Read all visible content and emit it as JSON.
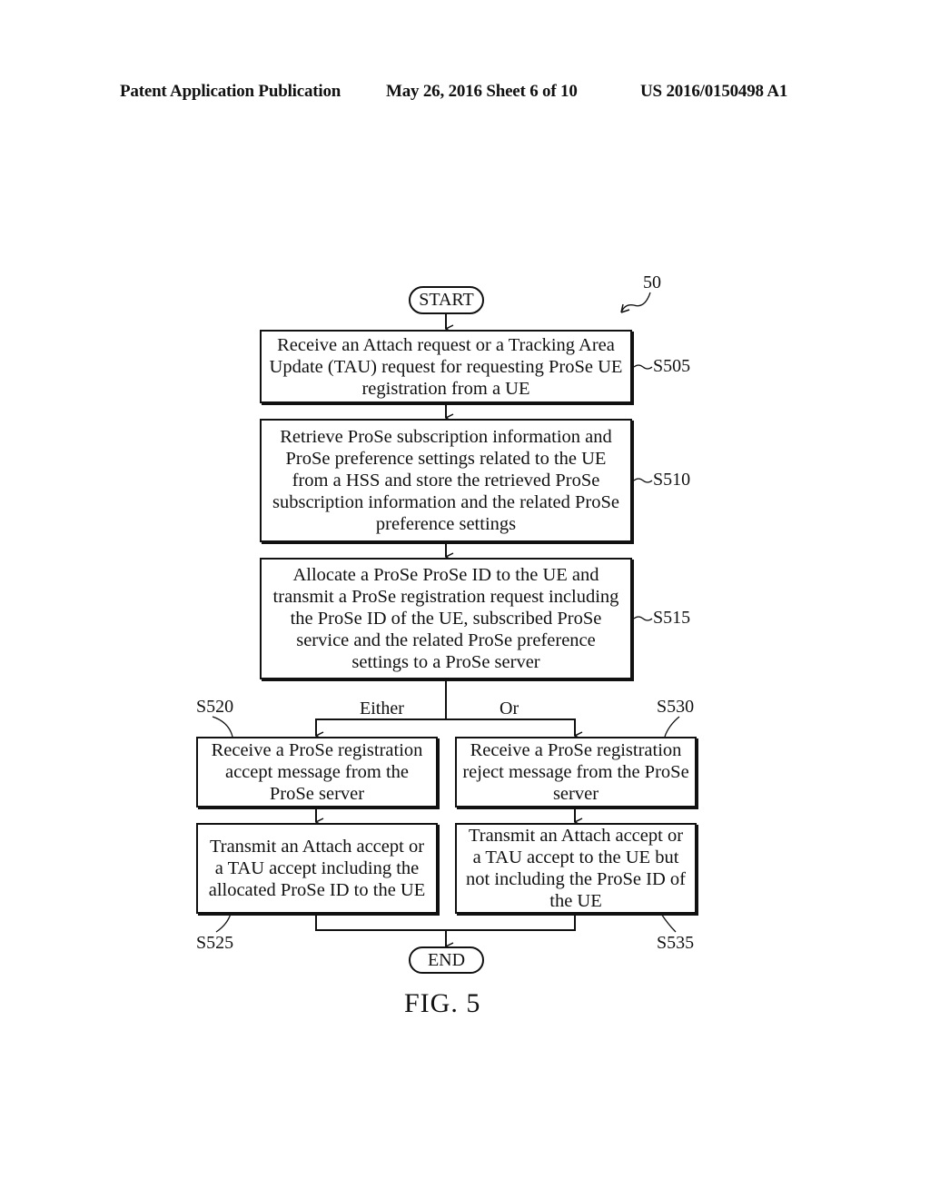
{
  "header": {
    "publication": "Patent Application Publication",
    "date_sheet": "May 26, 2016  Sheet 6 of 10",
    "number": "US 2016/0150498 A1"
  },
  "diagram": {
    "reference": "50",
    "start": "START",
    "end": "END",
    "steps": [
      {
        "id": "S505",
        "text": "Receive an Attach request or a Tracking Area Update (TAU) request for requesting ProSe UE registration from a UE"
      },
      {
        "id": "S510",
        "text": "Retrieve ProSe subscription information and ProSe preference settings related to the UE from a HSS and store the retrieved ProSe subscription information and the related ProSe preference settings"
      },
      {
        "id": "S515",
        "text": "Allocate a ProSe ProSe ID to the UE and transmit a ProSe registration request including the ProSe ID of the UE, subscribed ProSe service and the related ProSe preference settings to a ProSe server"
      },
      {
        "id": "S520",
        "text": "Receive a ProSe registration accept message from the ProSe server"
      },
      {
        "id": "S525",
        "text": "Transmit an Attach accept or a TAU accept including the allocated ProSe ID to the UE"
      },
      {
        "id": "S530",
        "text": "Receive a ProSe registration reject message from the ProSe server"
      },
      {
        "id": "S535",
        "text": "Transmit an Attach accept or a TAU accept to the UE but not including the ProSe ID of the UE"
      }
    ],
    "branch_labels": {
      "left": "Either",
      "right": "Or"
    },
    "caption": "FIG.  5"
  }
}
